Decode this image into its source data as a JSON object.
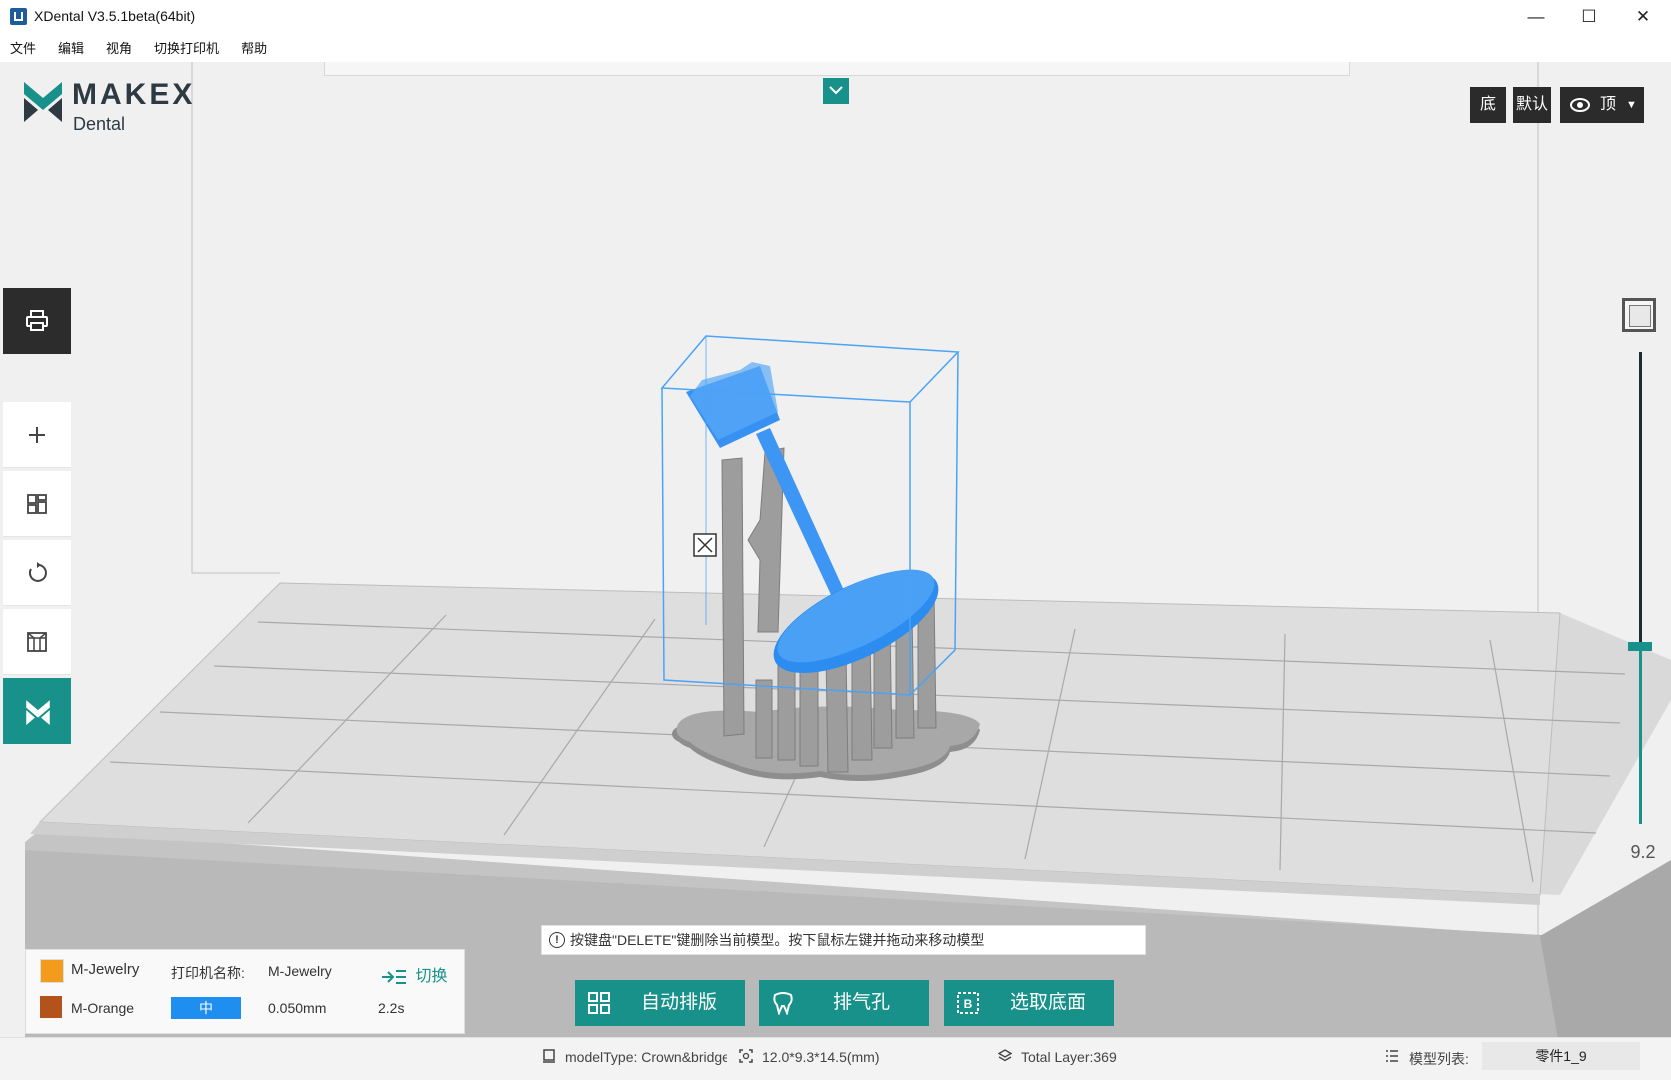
{
  "window": {
    "title": "XDental V3.5.1beta(64bit)",
    "minimize_glyph": "—",
    "maximize_glyph": "☐",
    "close_glyph": "✕"
  },
  "menu": [
    "文件",
    "编辑",
    "视角",
    "切换打印机",
    "帮助"
  ],
  "logo": {
    "brand": "MAKEX",
    "sub": "Dental"
  },
  "view_buttons": {
    "bottom": "底",
    "default": "默认",
    "top": "顶"
  },
  "slider": {
    "value": "9.2"
  },
  "printer_panel": {
    "printer_model": "M-Jewelry",
    "printer_name_label": "打印机名称:",
    "printer_name": "M-Jewelry",
    "switch_label": "切换",
    "material": "M-Orange",
    "quality": "中",
    "layer_thickness": "0.050mm",
    "exposure_time": "2.2s"
  },
  "hint": "按键盘\"DELETE\"键删除当前模型。按下鼠标左键并拖动来移动模型",
  "actions": {
    "auto_arrange": "自动排版",
    "vent_hole": "排气孔",
    "select_base": "选取底面"
  },
  "status": {
    "model_type": "modelType: Crown&bridge",
    "dimensions": "12.0*9.3*14.5(mm)",
    "total_layer": "Total Layer:369",
    "model_list_label": "模型列表:",
    "selected_part": "零件1_9"
  },
  "colors": {
    "accent": "#18918a",
    "model_blue": "#2d8cf0",
    "support_gray": "#9a9a9a",
    "dark_button": "#2b2b2b",
    "quality_blue": "#1e8ef0"
  },
  "icons": [
    "print-icon",
    "add-icon",
    "arrange-icon",
    "rotate-icon",
    "support-icon",
    "makex-logo-icon",
    "eye-icon",
    "chevron-down-icon",
    "info-icon",
    "switch-icon",
    "tooth-icon",
    "base-icon",
    "layers-icon",
    "list-icon",
    "size-icon",
    "model-icon"
  ]
}
